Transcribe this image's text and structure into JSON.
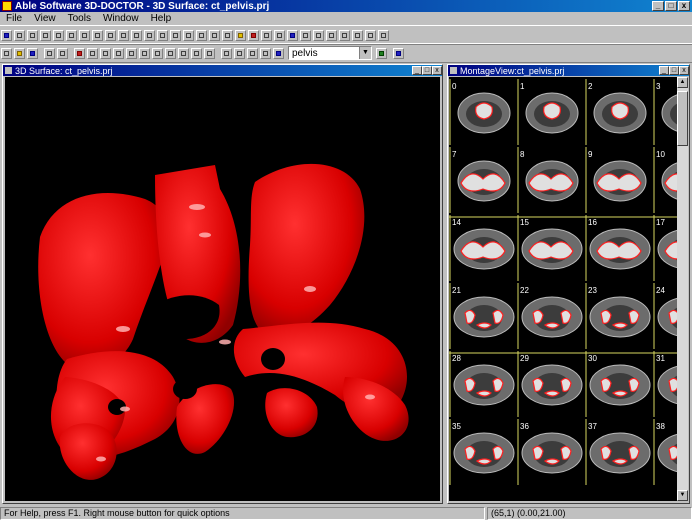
{
  "app": {
    "title": "Able Software 3D-DOCTOR - 3D Surface: ct_pelvis.prj",
    "window_buttons": [
      "_",
      "□",
      "x"
    ]
  },
  "menu": [
    "File",
    "View",
    "Tools",
    "Window",
    "Help"
  ],
  "toolbar": {
    "dataset_select": "pelvis"
  },
  "surface_window": {
    "title": "3D Surface: ct_pelvis.prj"
  },
  "montage_window": {
    "title": "MontageView:ct_pelvis.prj",
    "slices": [
      "0",
      "1",
      "2",
      "3",
      "7",
      "8",
      "9",
      "10",
      "14",
      "15",
      "16",
      "17",
      "21",
      "22",
      "23",
      "24",
      "28",
      "29",
      "30",
      "31",
      "35",
      "36",
      "37",
      "38"
    ]
  },
  "status": {
    "message": "For Help, press F1.  Right mouse button for quick options",
    "coords": "(65,1) (0.00,21.00)"
  },
  "colors": {
    "surface": "#e00000",
    "contour": "#ff2020",
    "title_bar": "#000080"
  }
}
